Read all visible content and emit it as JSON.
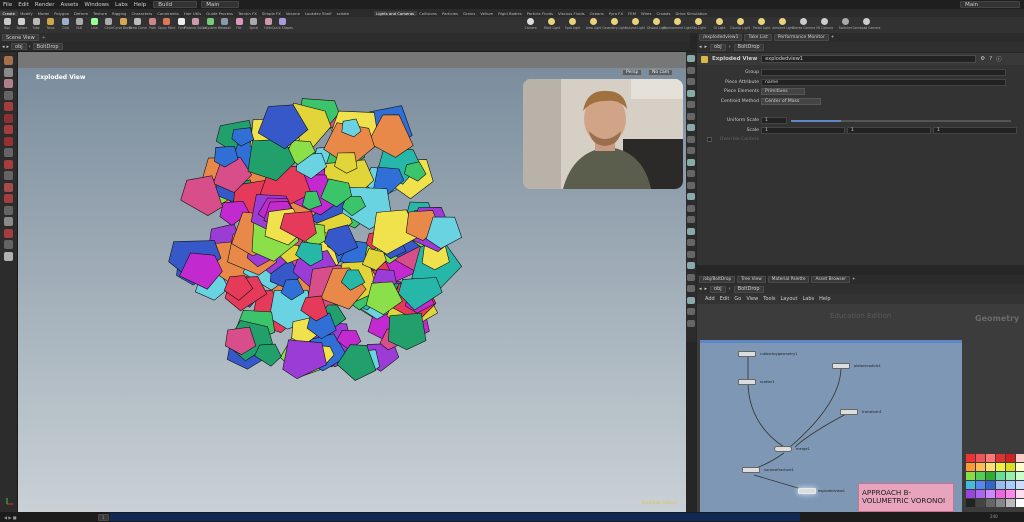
{
  "menu": [
    "File",
    "Edit",
    "Render",
    "Assets",
    "Windows",
    "Labs",
    "Help"
  ],
  "desktop": "Build",
  "network_ctx": "Main",
  "top_right_ctx": "Main",
  "shelf_tabs_left": [
    "Create",
    "Modify",
    "Model",
    "Polygon",
    "Deform",
    "Texture",
    "Rigging",
    "Characters",
    "Constraints",
    "Hair Utils",
    "Guide Process",
    "Terrain FX",
    "Simple FX",
    "Volume",
    "Lookdev Shelf",
    "scdate"
  ],
  "shelf_tabs_right": [
    "Lights and Cameras",
    "Collisions",
    "Particles",
    "Grains",
    "Vellum",
    "Rigid Bodies",
    "Particle Fluids",
    "Viscous Fluids",
    "Oceans",
    "Pyro FX",
    "FEM",
    "Wires",
    "Crowds",
    "Drive Simulation"
  ],
  "tools_left": [
    "Box",
    "Sphere",
    "Tube",
    "Torus",
    "Grid",
    "Null",
    "Line",
    "Circle",
    "Curve Bezier",
    "Draw Curve",
    "Path",
    "Spray Paint",
    "Font",
    "Platonic Solids",
    "L-System",
    "Metaball",
    "File",
    "Spiral",
    "Helix",
    "Quick Shapes"
  ],
  "tools_right": [
    "Camera",
    "Point Light",
    "Spot Light",
    "Area Light",
    "Geometry Light",
    "Volume Light",
    "Distant Light",
    "Environment Light",
    "Sky Light",
    "GI Light",
    "Caustic Light",
    "Portal Light",
    "Ambient Light",
    "Stereo Camera",
    "VR Camera",
    "Switcher",
    "Gamepad Camera"
  ],
  "left_pane": {
    "tabs": [
      "Scene View"
    ],
    "path": [
      "obj",
      "BoltDrop"
    ],
    "viewport_title": "Exploded View",
    "persp": "Persp",
    "cam": "No cam",
    "render_tag": "Education Edition"
  },
  "param_pane": {
    "tabs": [
      "/explodedview1",
      "Take List",
      "Performance Monitor"
    ],
    "path": [
      "obj",
      "BoltDrop"
    ],
    "node_type": "Exploded View",
    "node_name": "explodedview1",
    "params": [
      {
        "label": "Group",
        "value": ""
      },
      {
        "label": "Piece Attribute",
        "value": "name"
      },
      {
        "label": "Piece Elements",
        "value": "Primitives"
      },
      {
        "label": "Centroid Method",
        "value": "Center of Mass"
      },
      {
        "label": "Uniform Scale",
        "value": "1"
      },
      {
        "label": "Scale",
        "value": "1",
        "value2": "1",
        "value3": "1"
      },
      {
        "label": "Override Centers",
        "value": ""
      }
    ]
  },
  "network_pane": {
    "tabs": [
      "/obj/BoltDrop",
      "Tree View",
      "Material Palette",
      "Asset Browser"
    ],
    "path": [
      "obj",
      "BoltDrop"
    ],
    "menu": [
      "Add",
      "Edit",
      "Go",
      "View",
      "Tools",
      "Layout",
      "Labs",
      "Help"
    ],
    "watermark": "Education Edition",
    "context": "Geometry",
    "nodes": [
      "rubbertoygeometry1",
      "scatter1",
      "platonicsolids1",
      "voronoifracture1",
      "explodedview1",
      "merge1",
      "transform1"
    ],
    "sticky_note": "APPROACH B-VOLUMETRIC VORONOI"
  },
  "timeline": {
    "frame": "1",
    "end": "240"
  },
  "colors": {
    "accent": "#5d88c4",
    "sticky": "#e9a4bd",
    "viewport_top": "#7b8d9d",
    "viewport_bottom": "#c9d1d6"
  }
}
